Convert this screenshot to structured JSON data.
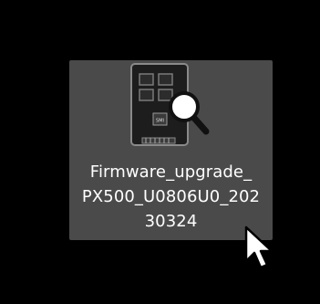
{
  "desktop": {
    "background": "#000000",
    "selected_item": {
      "icon": "file-magnifier-icon",
      "name_lines": [
        "Firmware_upgrade_",
        "PX500_U0806U0_202",
        "30324"
      ],
      "chip_label": "SMI",
      "highlight_color": "#4a4a4a"
    },
    "cursor": "arrow-cursor-icon"
  }
}
